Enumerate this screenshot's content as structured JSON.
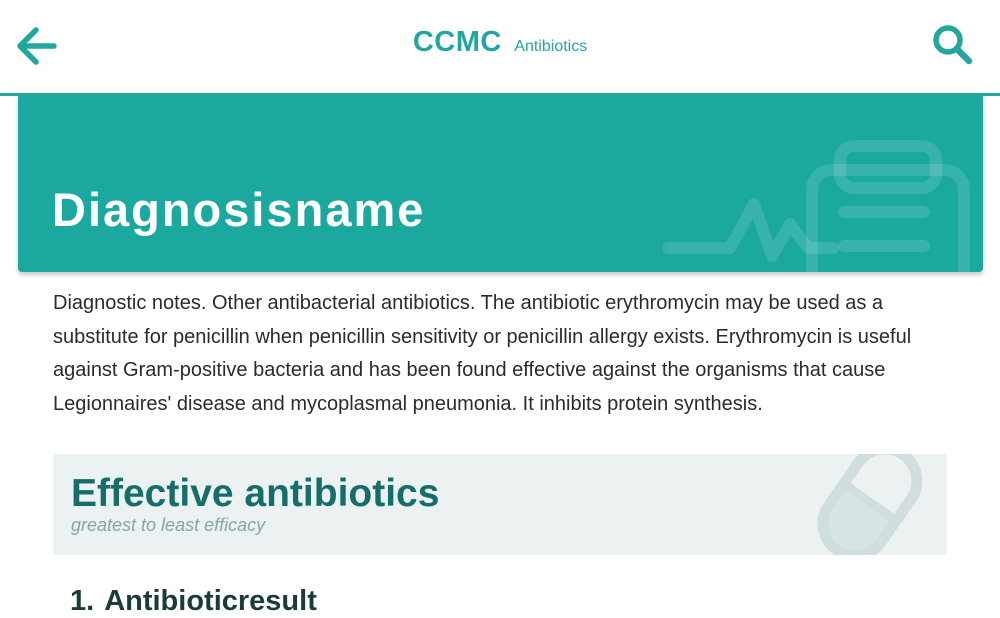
{
  "header": {
    "brand": "CCMC",
    "section": "Antibiotics"
  },
  "hero": {
    "title": "Diagnosisname"
  },
  "notes": "Diagnostic notes. Other antibacterial antibiotics. The antibiotic erythromycin may be used as a substitute for penicillin when penicillin sensitivity or penicillin allergy exists. Erythromycin is useful against Gram-positive bacteria and has been found effective against the organisms that cause Legionnaires' disease and mycoplasmal pneumonia. It inhibits protein synthesis.",
  "effective": {
    "title": "Effective antibiotics",
    "subtitle": "greatest to least efficacy",
    "items": [
      {
        "number": "1.",
        "name": "Antibioticresult"
      }
    ]
  },
  "icons": {
    "back": "arrow-left-icon",
    "search": "search-icon",
    "hero_decoration": "clipboard-heartbeat-icon",
    "card_decoration": "pill-icon"
  },
  "colors": {
    "accent": "#1aa89f",
    "accent_dark": "#166e6a",
    "card_bg": "#ecf2f2",
    "text": "#2b2b2b"
  }
}
